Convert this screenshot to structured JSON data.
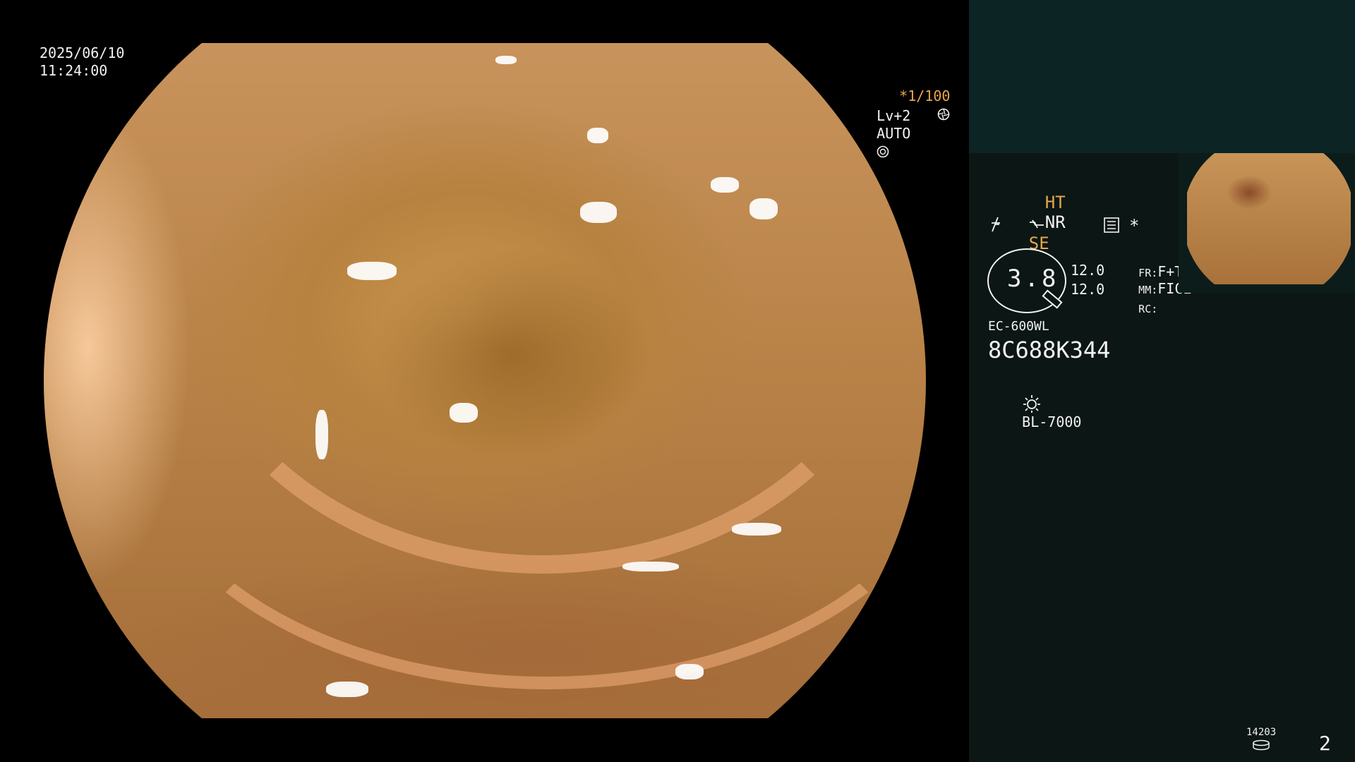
{
  "osd": {
    "date": "2025/06/10",
    "time": "11:24:00",
    "shutter": "*1/100",
    "shutter_icon": "aperture-icon",
    "level": "Lv+2",
    "iris": "AUTO",
    "iris_icon": "iris-icon"
  },
  "panel": {
    "ht": "HT",
    "nr": "NR",
    "se": "SE",
    "zoom_value": "3.8",
    "val1": "12.0",
    "val2": "12.0",
    "fr_label": "FR:",
    "fr_value": "F+T",
    "mm_label": "MM:",
    "mm_value": "FICE",
    "rc_label": "RC:",
    "scope_model": "EC-600WL",
    "serial": "8C688K344",
    "light_source": "BL-7000",
    "counter": "14203",
    "page": "2"
  },
  "colors": {
    "accent": "#e8a64a",
    "panel_bg": "#0b1615",
    "panel_top": "#0d2425"
  }
}
